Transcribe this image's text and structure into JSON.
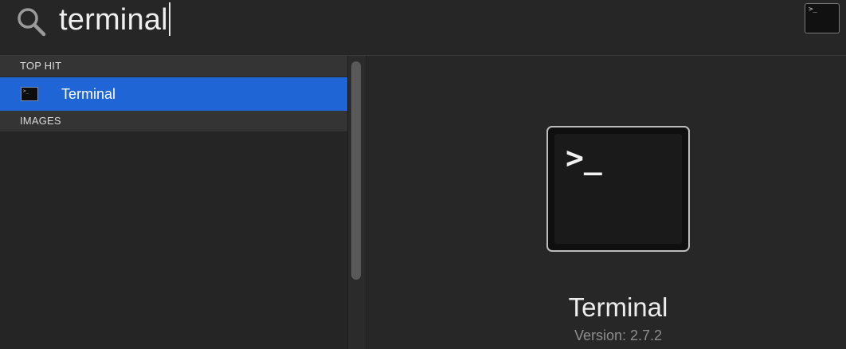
{
  "search": {
    "query": "terminal"
  },
  "results": {
    "sections": [
      {
        "header": "TOP HIT",
        "items": [
          {
            "label": "Terminal",
            "selected": true,
            "icon": "terminal-app-icon"
          }
        ]
      },
      {
        "header": "IMAGES",
        "items": []
      }
    ]
  },
  "preview": {
    "app_name": "Terminal",
    "version": "Version: 2.7.2",
    "prompt_glyph": ">_"
  },
  "icons": {
    "search": "search-icon",
    "terminal": "terminal-app-icon"
  },
  "colors": {
    "selection": "#1f65d6",
    "background": "#262626",
    "section_header": "#343434"
  }
}
